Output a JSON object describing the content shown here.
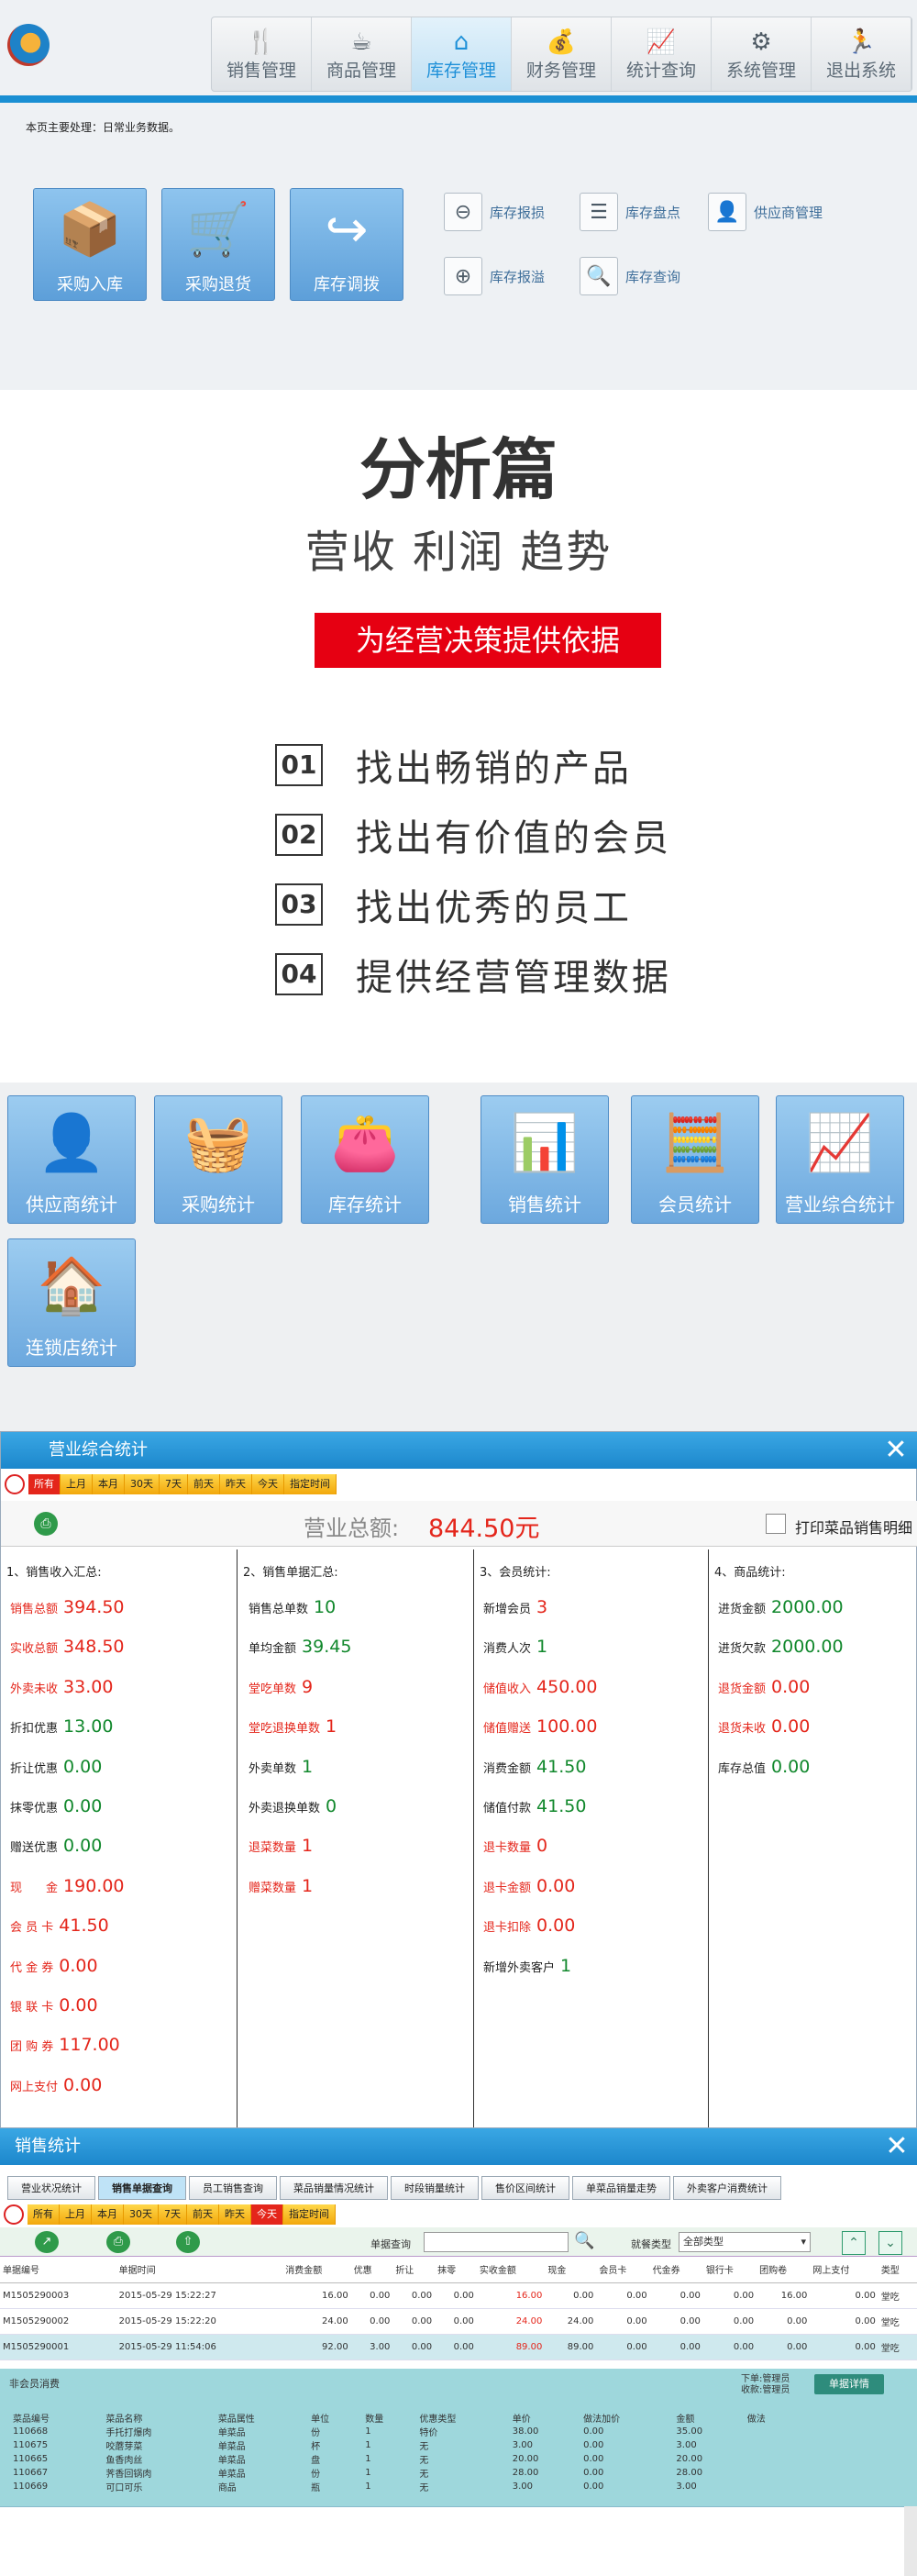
{
  "app": {
    "nav": [
      {
        "label": "销售管理",
        "icon": "fork-knife-icon",
        "glyph": "🍴"
      },
      {
        "label": "商品管理",
        "icon": "coffee-cup-icon",
        "glyph": "☕"
      },
      {
        "label": "库存管理",
        "icon": "house-icon",
        "glyph": "⌂"
      },
      {
        "label": "财务管理",
        "icon": "money-bag-icon",
        "glyph": "💰"
      },
      {
        "label": "统计查询",
        "icon": "line-chart-icon",
        "glyph": "📈"
      },
      {
        "label": "系统管理",
        "icon": "gear-icon",
        "glyph": "⚙"
      },
      {
        "label": "退出系统",
        "icon": "running-man-icon",
        "glyph": "🏃"
      }
    ],
    "active_nav": "库存管理",
    "notice": "本页主要处理：日常业务数据。",
    "big_buttons": [
      {
        "label": "采购入库",
        "icon": "cart-boxes-icon",
        "glyph": "📦"
      },
      {
        "label": "采购退货",
        "icon": "shopping-basket-icon",
        "glyph": "🛒"
      },
      {
        "label": "库存调拨",
        "icon": "curved-arrow-icon",
        "glyph": "↪"
      }
    ],
    "small_buttons": [
      {
        "label": "库存报损",
        "icon": "minus-circle-icon",
        "glyph": "⊖"
      },
      {
        "label": "库存盘点",
        "icon": "list-icon",
        "glyph": "☰"
      },
      {
        "label": "供应商管理",
        "icon": "person-card-icon",
        "glyph": "👤"
      },
      {
        "label": "库存报溢",
        "icon": "plus-circle-icon",
        "glyph": "⊕"
      },
      {
        "label": "库存查询",
        "icon": "magnifier-icon",
        "glyph": "🔍"
      }
    ]
  },
  "analysis": {
    "title": "分析篇",
    "subtitle": "营收 利润 趋势",
    "banner": "为经营决策提供依据",
    "points": [
      {
        "num": "01",
        "text": "找出畅销的产品"
      },
      {
        "num": "02",
        "text": "找出有价值的会员"
      },
      {
        "num": "03",
        "text": "找出优秀的员工"
      },
      {
        "num": "04",
        "text": "提供经营管理数据"
      }
    ]
  },
  "stats_tiles": [
    {
      "label": "供应商统计",
      "icon": "supplier-person-icon",
      "glyph": "👤"
    },
    {
      "label": "采购统计",
      "icon": "basket-icon",
      "glyph": "🧺"
    },
    {
      "label": "库存统计",
      "icon": "wallet-icon",
      "glyph": "👛"
    },
    {
      "label": "销售统计",
      "icon": "bar-chart-icon",
      "glyph": "📊"
    },
    {
      "label": "会员统计",
      "icon": "calculator-icon",
      "glyph": "🧮"
    },
    {
      "label": "营业综合统计",
      "icon": "trend-chart-icon",
      "glyph": "📈"
    },
    {
      "label": "连锁店统计",
      "icon": "store-house-icon",
      "glyph": "🏠"
    }
  ],
  "summary": {
    "window_title": "营业综合统计",
    "filters": [
      "所有",
      "上月",
      "本月",
      "30天",
      "7天",
      "前天",
      "昨天",
      "今天",
      "指定时间"
    ],
    "selected_filter": "所有",
    "total_label": "营业总额:",
    "total_value": "844.50元",
    "print_label": "打印菜品销售明细",
    "columns": [
      {
        "header": "1、销售收入汇总:",
        "rows": [
          {
            "label": "销售总额",
            "value": "394.50",
            "lc": "red",
            "vc": "red"
          },
          {
            "label": "实收总额",
            "value": "348.50",
            "lc": "red",
            "vc": "red"
          },
          {
            "label": "外卖未收",
            "value": "33.00",
            "lc": "red",
            "vc": "red"
          },
          {
            "label": "折扣优惠",
            "value": "13.00",
            "lc": "blk",
            "vc": "grn"
          },
          {
            "label": "折让优惠",
            "value": "0.00",
            "lc": "blk",
            "vc": "grn"
          },
          {
            "label": "抹零优惠",
            "value": "0.00",
            "lc": "blk",
            "vc": "grn"
          },
          {
            "label": "赠送优惠",
            "value": "0.00",
            "lc": "blk",
            "vc": "grn"
          },
          {
            "label": "现　　金",
            "value": "190.00",
            "lc": "red",
            "vc": "red"
          },
          {
            "label": "会 员 卡",
            "value": "41.50",
            "lc": "red",
            "vc": "red"
          },
          {
            "label": "代 金 券",
            "value": "0.00",
            "lc": "red",
            "vc": "red"
          },
          {
            "label": "银 联 卡",
            "value": "0.00",
            "lc": "red",
            "vc": "red"
          },
          {
            "label": "团 购 券",
            "value": "117.00",
            "lc": "red",
            "vc": "red"
          },
          {
            "label": "网上支付",
            "value": "0.00",
            "lc": "red",
            "vc": "red"
          }
        ]
      },
      {
        "header": "2、销售单据汇总:",
        "rows": [
          {
            "label": "销售总单数",
            "value": "10",
            "lc": "blk",
            "vc": "grn"
          },
          {
            "label": "单均金额",
            "value": "39.45",
            "lc": "blk",
            "vc": "grn"
          },
          {
            "label": "堂吃单数",
            "value": "9",
            "lc": "red",
            "vc": "red"
          },
          {
            "label": "堂吃退换单数",
            "value": "1",
            "lc": "red",
            "vc": "red"
          },
          {
            "label": "外卖单数",
            "value": "1",
            "lc": "blk",
            "vc": "grn"
          },
          {
            "label": "外卖退换单数",
            "value": "0",
            "lc": "blk",
            "vc": "grn"
          },
          {
            "label": "退菜数量",
            "value": "1",
            "lc": "red",
            "vc": "red"
          },
          {
            "label": "赠菜数量",
            "value": "1",
            "lc": "red",
            "vc": "red"
          }
        ]
      },
      {
        "header": "3、会员统计:",
        "rows": [
          {
            "label": "新增会员",
            "value": "3",
            "lc": "blk",
            "vc": "red"
          },
          {
            "label": "消费人次",
            "value": "1",
            "lc": "blk",
            "vc": "grn"
          },
          {
            "label": "储值收入",
            "value": "450.00",
            "lc": "red",
            "vc": "red"
          },
          {
            "label": "储值赠送",
            "value": "100.00",
            "lc": "red",
            "vc": "red"
          },
          {
            "label": "消费金额",
            "value": "41.50",
            "lc": "blk",
            "vc": "grn"
          },
          {
            "label": "储值付款",
            "value": "41.50",
            "lc": "blk",
            "vc": "grn"
          },
          {
            "label": "退卡数量",
            "value": "0",
            "lc": "red",
            "vc": "red"
          },
          {
            "label": "退卡金额",
            "value": "0.00",
            "lc": "red",
            "vc": "red"
          },
          {
            "label": "退卡扣除",
            "value": "0.00",
            "lc": "red",
            "vc": "red"
          },
          {
            "label": "新增外卖客户",
            "value": "1",
            "lc": "blk",
            "vc": "grn"
          }
        ]
      },
      {
        "header": "4、商品统计:",
        "rows": [
          {
            "label": "进货金额",
            "value": "2000.00",
            "lc": "blk",
            "vc": "grn"
          },
          {
            "label": "进货欠款",
            "value": "2000.00",
            "lc": "blk",
            "vc": "grn"
          },
          {
            "label": "退货金额",
            "value": "0.00",
            "lc": "red",
            "vc": "red"
          },
          {
            "label": "退货未收",
            "value": "0.00",
            "lc": "red",
            "vc": "red"
          },
          {
            "label": "库存总值",
            "value": "0.00",
            "lc": "blk",
            "vc": "grn"
          }
        ]
      }
    ]
  },
  "sales": {
    "window_title": "销售统计",
    "tabs": [
      "营业状况统计",
      "销售单据查询",
      "员工销售查询",
      "菜品销量情况统计",
      "时段销量统计",
      "售价区间统计",
      "单菜品销量走势",
      "外卖客户消费统计"
    ],
    "selected_tab": "销售单据查询",
    "filters": [
      "所有",
      "上月",
      "本月",
      "30天",
      "7天",
      "前天",
      "昨天",
      "今天",
      "指定时间"
    ],
    "selected_filter": "今天",
    "query_label": "单据查询",
    "type_label": "就餐类型",
    "type_value": "全部类型",
    "headers": [
      "单据编号",
      "单据时间",
      "消费金额",
      "优惠",
      "折让",
      "抹零",
      "实收金额",
      "现金",
      "会员卡",
      "代金券",
      "银行卡",
      "团购卷",
      "网上支付",
      "类型"
    ],
    "rows": [
      [
        "M1505290003",
        "2015-05-29 15:22:27",
        "16.00",
        "0.00",
        "0.00",
        "0.00",
        "16.00",
        "0.00",
        "0.00",
        "0.00",
        "0.00",
        "16.00",
        "0.00",
        "堂吃"
      ],
      [
        "M1505290002",
        "2015-05-29 15:22:20",
        "24.00",
        "0.00",
        "0.00",
        "0.00",
        "24.00",
        "24.00",
        "0.00",
        "0.00",
        "0.00",
        "0.00",
        "0.00",
        "堂吃"
      ],
      [
        "M1505290001",
        "2015-05-29 11:54:06",
        "92.00",
        "3.00",
        "0.00",
        "0.00",
        "89.00",
        "89.00",
        "0.00",
        "0.00",
        "0.00",
        "0.00",
        "0.00",
        "堂吃"
      ]
    ],
    "detail_label": "非会员消费",
    "operator_line1": "下单:管理员",
    "operator_line2": "收款:管理员",
    "detail_button": "单据详情",
    "detail_headers": [
      "菜品编号",
      "菜品名称",
      "菜品属性",
      "单位",
      "数量",
      "优惠类型",
      "单价",
      "做法加价",
      "金额",
      "做法"
    ],
    "detail_rows": [
      [
        "110668",
        "手托打爆肉",
        "单菜品",
        "份",
        "1",
        "特价",
        "38.00",
        "0.00",
        "35.00",
        ""
      ],
      [
        "110675",
        "咬蘑芽菜",
        "单菜品",
        "杯",
        "1",
        "无",
        "3.00",
        "0.00",
        "3.00",
        ""
      ],
      [
        "110665",
        "鱼香肉丝",
        "单菜品",
        "盘",
        "1",
        "无",
        "20.00",
        "0.00",
        "20.00",
        ""
      ],
      [
        "110667",
        "荠香回锅肉",
        "单菜品",
        "份",
        "1",
        "无",
        "28.00",
        "0.00",
        "28.00",
        ""
      ],
      [
        "110669",
        "可口可乐",
        "商品",
        "瓶",
        "1",
        "无",
        "3.00",
        "0.00",
        "3.00",
        ""
      ]
    ]
  }
}
